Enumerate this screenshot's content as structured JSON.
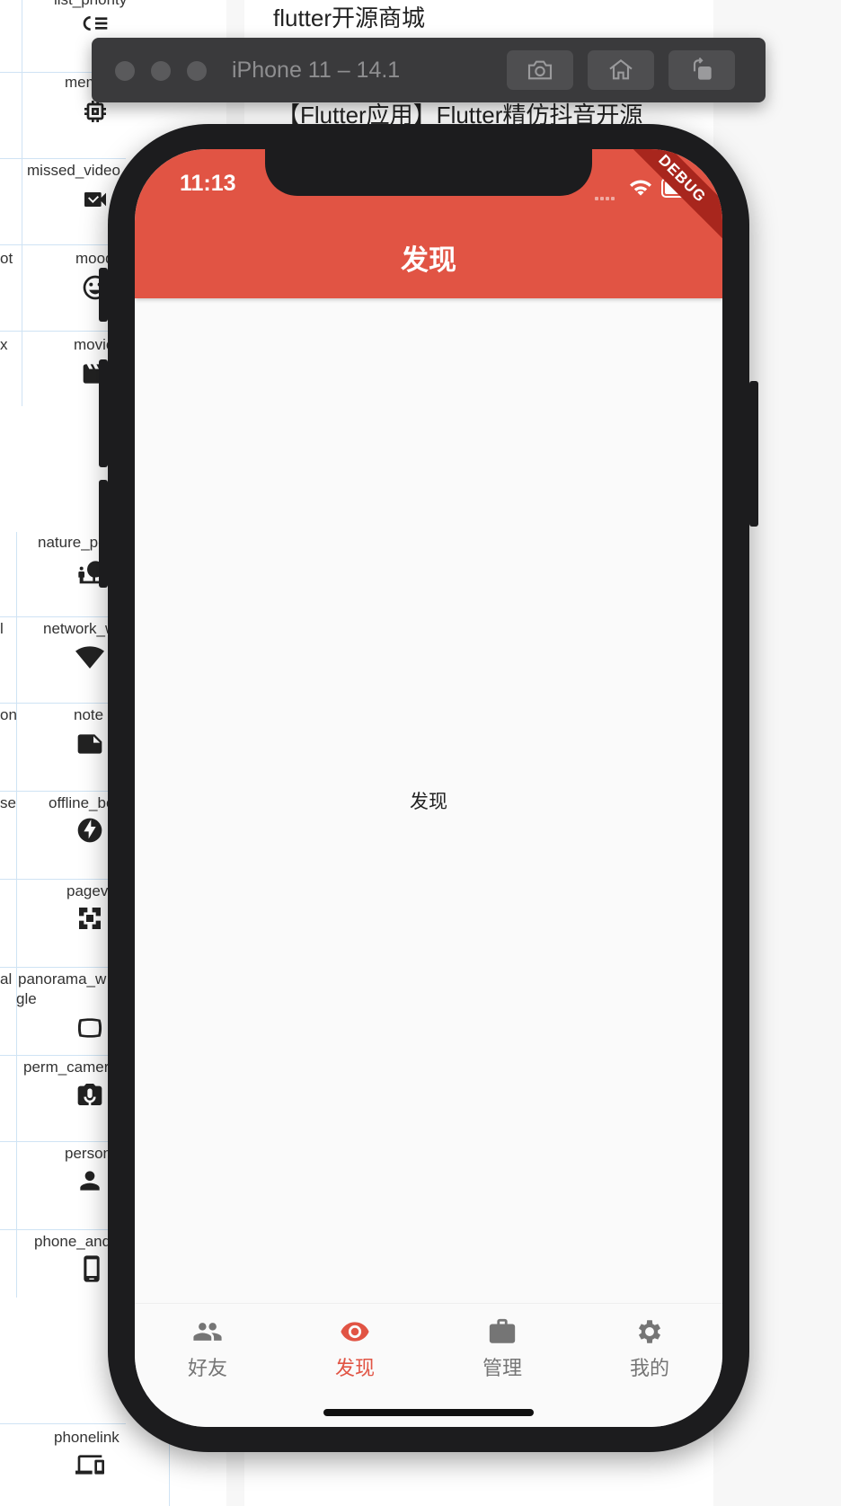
{
  "background": {
    "gallery_labels": [
      "list_priority",
      "memory",
      "missed_video_call",
      "mood",
      "movie",
      "nature_people",
      "network_wifi",
      "note",
      "offline_bolt",
      "pageview",
      "panorama_wide_angle",
      "perm_camera_mic",
      "person",
      "phone_android",
      "phonelink"
    ],
    "left_partial_labels": [
      "ot",
      "x",
      "l",
      "on",
      "se",
      "al"
    ],
    "articles": [
      "flutter开源商城",
      "【Flutter应用】Flutter精仿抖音开源"
    ]
  },
  "simulator": {
    "title": "iPhone 11 – 14.1"
  },
  "status_bar": {
    "time": "11:13",
    "debug_banner": "DEBUG"
  },
  "app_bar": {
    "title": "发现",
    "color": "#e15444"
  },
  "body": {
    "text": "发现"
  },
  "bottom_nav": {
    "active_color": "#e15444",
    "inactive_color": "#757575",
    "items": [
      {
        "label": "好友",
        "icon": "people-icon",
        "active": false
      },
      {
        "label": "发现",
        "icon": "eye-icon",
        "active": true
      },
      {
        "label": "管理",
        "icon": "briefcase-icon",
        "active": false
      },
      {
        "label": "我的",
        "icon": "gear-icon",
        "active": false
      }
    ]
  }
}
